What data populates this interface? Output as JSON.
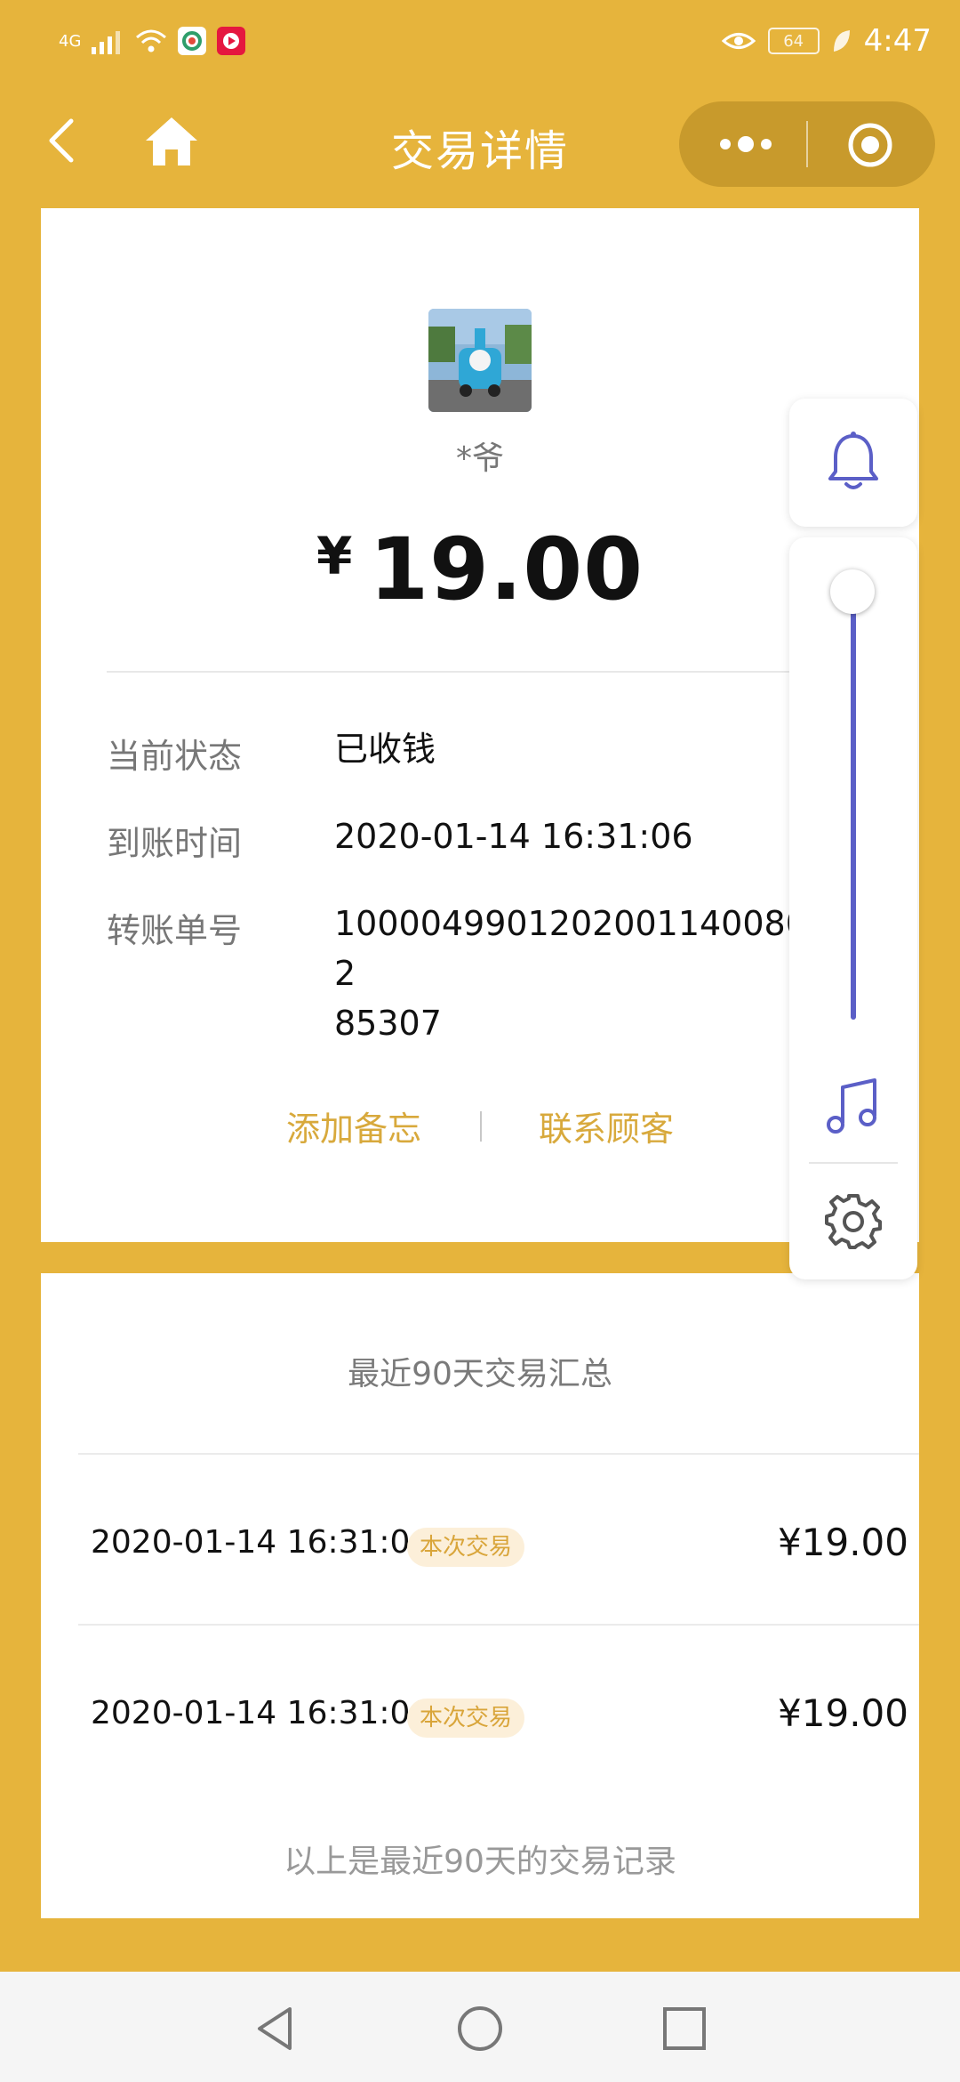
{
  "status_bar": {
    "network": "4G",
    "battery": "64",
    "time": "4:47"
  },
  "nav": {
    "title": "交易详情",
    "back_icon": "back-chevron-icon",
    "home_icon": "home-icon",
    "more_icon": "more-dots-icon",
    "close_icon": "target-close-icon"
  },
  "transaction": {
    "payer_name": "*爷",
    "currency_symbol": "¥",
    "amount": "19.00",
    "rows": [
      {
        "label": "当前状态",
        "value": "已收钱"
      },
      {
        "label": "到账时间",
        "value": "2020-01-14 16:31:06"
      },
      {
        "label": "转账单号",
        "value": "100004990120200114008082\n85307"
      }
    ],
    "actions": {
      "add_note": "添加备忘",
      "contact_customer": "联系顾客"
    }
  },
  "summary": {
    "title": "最近90天交易汇总",
    "records": [
      {
        "date": "2020-01-14 16:31:06",
        "badge": "本次交易",
        "amount": "¥19.00"
      },
      {
        "date": "2020-01-14 16:31:06",
        "badge": "本次交易",
        "amount": "¥19.00"
      }
    ],
    "footer": "以上是最近90天的交易记录"
  },
  "floating_panel": {
    "icons": [
      "bell-icon",
      "music-note-icon",
      "gear-icon"
    ],
    "accent_color": "#5B5FC7",
    "volume_level": 1.0
  },
  "theme": {
    "brand_color": "#E6B43C",
    "link_color": "#D8A93C"
  }
}
